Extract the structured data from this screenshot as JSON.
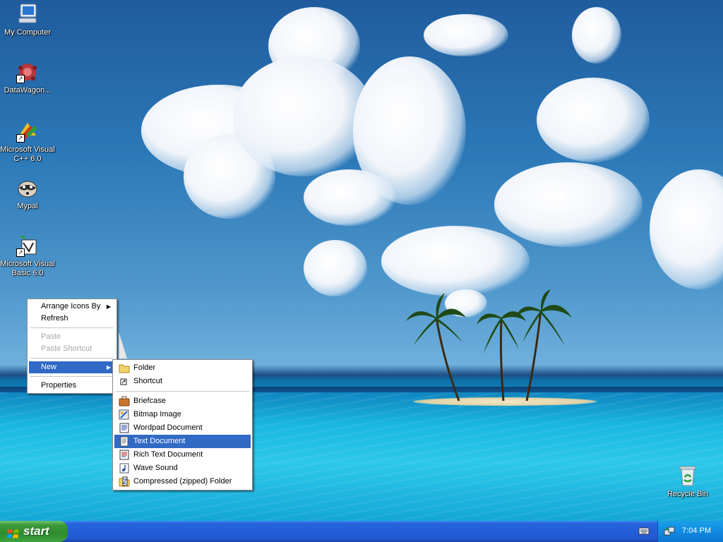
{
  "desktop_icons": [
    {
      "label": "My Computer",
      "icon": "my-computer-icon"
    },
    {
      "label": "DataWagon...",
      "icon": "datawagon-icon"
    },
    {
      "label": "Microsoft Visual C++ 6.0",
      "icon": "visual-cpp-icon"
    },
    {
      "label": "Mypal",
      "icon": "mypal-icon"
    },
    {
      "label": "Microsoft Visual Basic 6.0",
      "icon": "visual-basic-icon"
    },
    {
      "label": "Recycle Bin",
      "icon": "recycle-bin-icon"
    }
  ],
  "context_menu": {
    "arrange_icons_by": "Arrange Icons By",
    "refresh": "Refresh",
    "paste": "Paste",
    "paste_shortcut": "Paste Shortcut",
    "new": "New",
    "properties": "Properties"
  },
  "new_submenu": {
    "folder": "Folder",
    "shortcut": "Shortcut",
    "briefcase": "Briefcase",
    "bitmap_image": "Bitmap Image",
    "wordpad_document": "Wordpad Document",
    "text_document": "Text Document",
    "rich_text_document": "Rich Text Document",
    "wave_sound": "Wave Sound",
    "compressed_folder": "Compressed (zipped) Folder"
  },
  "taskbar": {
    "start_label": "start",
    "clock": "7:04 PM"
  },
  "colors": {
    "highlight": "#316ac5",
    "taskbar": "#245edb",
    "start_button": "#3c9a3c"
  }
}
